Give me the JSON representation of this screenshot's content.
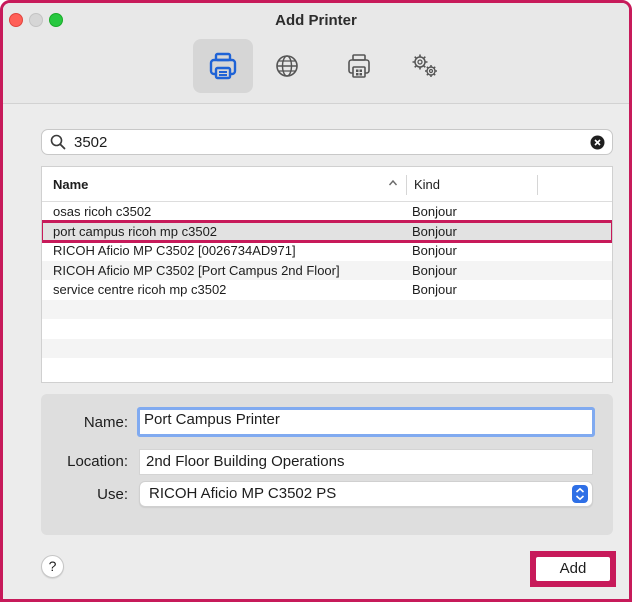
{
  "window": {
    "title": "Add Printer"
  },
  "toolbar": {
    "items": [
      {
        "icon": "default-printer-icon",
        "selected": true
      },
      {
        "icon": "ip-globe-icon",
        "selected": false
      },
      {
        "icon": "windows-printer-icon",
        "selected": false
      },
      {
        "icon": "advanced-gears-icon",
        "selected": false
      }
    ]
  },
  "search": {
    "value": "3502",
    "icon": "search-icon",
    "clear_icon": "clear-icon"
  },
  "list": {
    "columns": {
      "name": "Name",
      "kind": "Kind"
    },
    "rows": [
      {
        "name": "osas ricoh c3502",
        "kind": "Bonjour"
      },
      {
        "name": "port campus ricoh mp c3502",
        "kind": "Bonjour"
      },
      {
        "name": "RICOH Aficio MP C3502 [0026734AD971]",
        "kind": "Bonjour"
      },
      {
        "name": "RICOH Aficio MP C3502 [Port Campus 2nd Floor]",
        "kind": "Bonjour"
      },
      {
        "name": "service centre ricoh mp c3502",
        "kind": "Bonjour"
      }
    ]
  },
  "details": {
    "name_label": "Name:",
    "name_value": "Port Campus Printer",
    "location_label": "Location:",
    "location_value": "2nd Floor Building Operations",
    "use_label": "Use:",
    "use_value": "RICOH Aficio MP C3502 PS"
  },
  "footer": {
    "help_label": "?",
    "add_label": "Add"
  },
  "colors": {
    "highlight": "#c71a5a",
    "accent": "#2e6fe6",
    "focus_ring": "#80aaf0"
  }
}
